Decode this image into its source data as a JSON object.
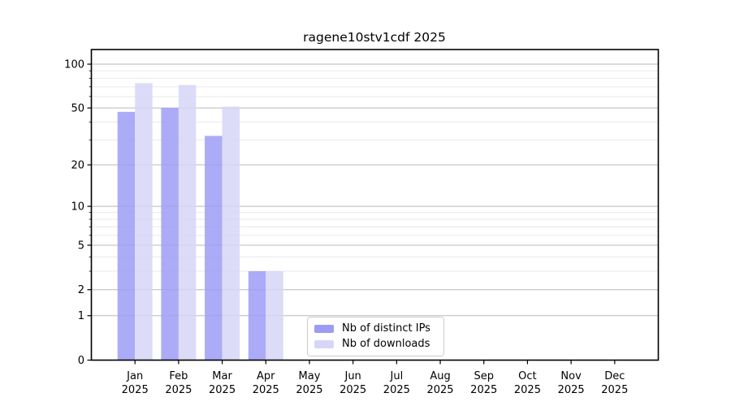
{
  "title": "ragene10stv1cdf 2025",
  "chart_data": {
    "type": "bar",
    "title": "ragene10stv1cdf 2025",
    "categories": [
      "Jan",
      "Feb",
      "Mar",
      "Apr",
      "May",
      "Jun",
      "Jul",
      "Aug",
      "Sep",
      "Oct",
      "Nov",
      "Dec"
    ],
    "x_tick_year": "2025",
    "series": [
      {
        "name": "Nb of distinct IPs",
        "color": "#9c9cf6",
        "values": [
          47,
          50,
          32,
          3,
          0,
          0,
          0,
          0,
          0,
          0,
          0,
          0
        ]
      },
      {
        "name": "Nb of downloads",
        "color": "#d6d6f8",
        "values": [
          74,
          72,
          51,
          3,
          0,
          0,
          0,
          0,
          0,
          0,
          0,
          0
        ]
      }
    ],
    "yscale": "log1p",
    "ylim": [
      0,
      126
    ],
    "y_major_ticks": [
      0,
      1,
      2,
      5,
      10,
      20,
      50,
      100
    ],
    "y_minor_ticks": [
      3,
      4,
      6,
      7,
      8,
      9,
      30,
      40,
      60,
      70,
      80,
      90
    ],
    "grid": true,
    "legend_position": "lower-center",
    "colors": {
      "grid_major": "#b8b8b8",
      "grid_minor": "#e9e9e9",
      "spine": "#000000",
      "text": "#000000",
      "legend_border": "#cccccc"
    }
  }
}
